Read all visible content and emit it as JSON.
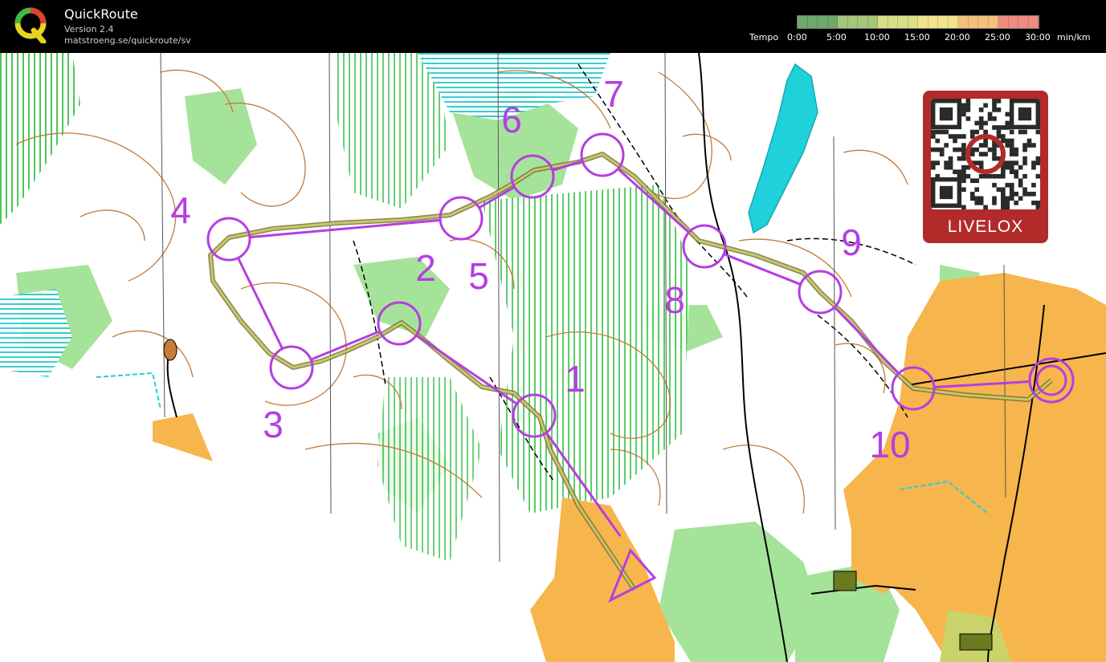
{
  "app": {
    "title": "QuickRoute",
    "version": "Version 2.4",
    "url": "matstroeng.se/quickroute/sv"
  },
  "tempo_scale": {
    "label": "Tempo",
    "ticks": [
      "0:00",
      "5:00",
      "10:00",
      "15:00",
      "20:00",
      "25:00",
      "30:00"
    ],
    "unit": "min/km",
    "colors": [
      "#6fa86a",
      "#a6c67a",
      "#d9df86",
      "#f1e48a",
      "#f3c07f",
      "#ee8c80"
    ]
  },
  "course": {
    "color": "#b53ee0",
    "start_label": "",
    "controls": [
      {
        "label": "1"
      },
      {
        "label": "2"
      },
      {
        "label": "3"
      },
      {
        "label": "4"
      },
      {
        "label": "5"
      },
      {
        "label": "6"
      },
      {
        "label": "7"
      },
      {
        "label": "8"
      },
      {
        "label": "9"
      },
      {
        "label": "10"
      }
    ]
  },
  "badge": {
    "label": "LIVELOX",
    "icon": "qr-code-icon"
  },
  "colors": {
    "open_land": "#f7b54e",
    "forest": "#ffffff",
    "green": "#a6e39a",
    "water": "#1fd1da",
    "contour": "#c27a3a",
    "route": "#c9c66b"
  }
}
